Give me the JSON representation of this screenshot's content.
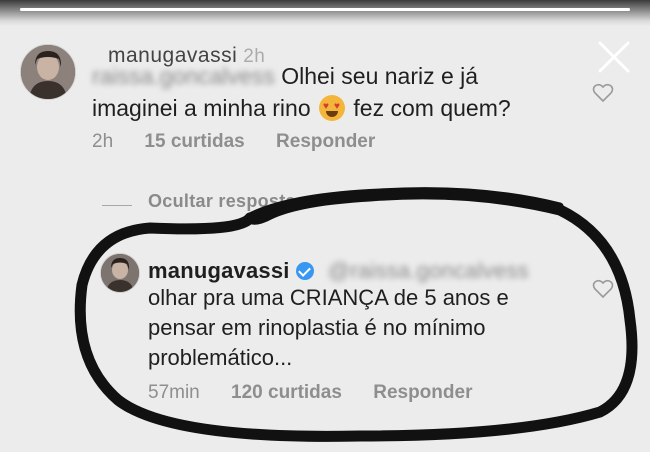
{
  "story": {
    "progress": 1.0
  },
  "comment": {
    "username": "manugavassi",
    "timestamp": "2h",
    "mention": "raissa.goncalvess",
    "text_part1": "Olhei seu nariz e já",
    "text_part2": "imaginei a minha rino",
    "emoji": "smiling-face-with-heart-eyes",
    "text_part3": "fez com quem?",
    "time": "2h",
    "likes": "15 curtidas",
    "reply_label": "Responder"
  },
  "hide_replies_label": "Ocultar respostas",
  "reply": {
    "username": "manugavassi",
    "verified": true,
    "mention": "@raissa.goncalvess",
    "line1": "olhar pra uma CRIANÇA de 5 anos e",
    "line2": "pensar em rinoplastia é no mínimo",
    "line3": "problemático...",
    "time": "57min",
    "likes": "120 curtidas",
    "reply_label": "Responder"
  },
  "colors": {
    "verified": "#3897f0",
    "background": "#ececec",
    "scribble": "#111111"
  }
}
